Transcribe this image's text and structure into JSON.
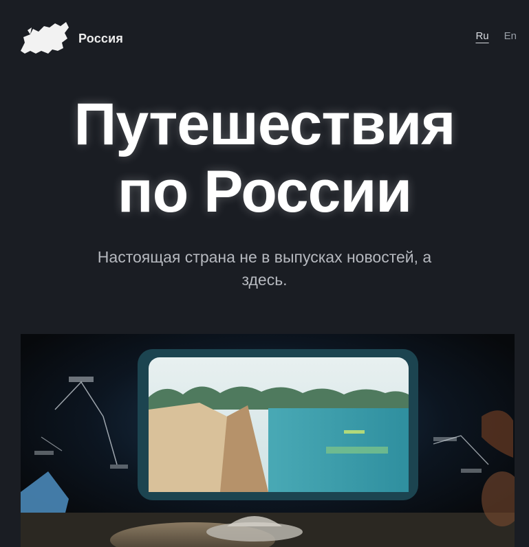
{
  "header": {
    "logo_text": "Россия",
    "languages": [
      {
        "code": "ru",
        "label": "Ru",
        "active": true
      },
      {
        "code": "en",
        "label": "En",
        "active": false
      }
    ]
  },
  "hero": {
    "title_line1": "Путешествия",
    "title_line2": "по России",
    "subtitle": "Настоящая страна не в выпусках новостей, а здесь."
  },
  "colors": {
    "background": "#1a1d23",
    "title": "#ffffff",
    "subtitle": "#b6b9bf",
    "lang_inactive": "#9aa0a8"
  },
  "icons": {
    "logo": "russia-map-icon"
  }
}
